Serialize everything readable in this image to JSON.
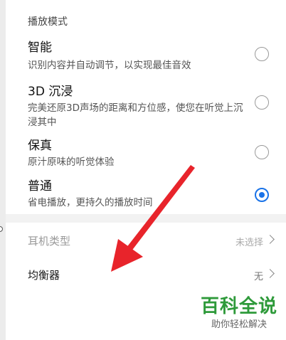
{
  "section": {
    "header": "播放模式"
  },
  "options": [
    {
      "title": "智能",
      "desc": "识别内容并自动调节，以实现最佳音效",
      "selected": false
    },
    {
      "title": "3D 沉浸",
      "desc": "完美还原3D声场的距离和方位感，使您在听觉上沉浸其中",
      "selected": false
    },
    {
      "title": "保真",
      "desc": "原汁原味的听觉体验",
      "selected": false
    },
    {
      "title": "普通",
      "desc": "省电播放，更持久的播放时间",
      "selected": true
    }
  ],
  "settings": {
    "earphone_type": {
      "label": "耳机类型",
      "value": "未选择"
    },
    "equalizer": {
      "label": "均衡器",
      "value": "无"
    }
  },
  "watermark": {
    "title": "百科全说",
    "subtitle": "助你轻松解决"
  },
  "colors": {
    "accent": "#1a73e8",
    "annotation_arrow": "#e8242b",
    "watermark_green": "#2e9a3a"
  }
}
